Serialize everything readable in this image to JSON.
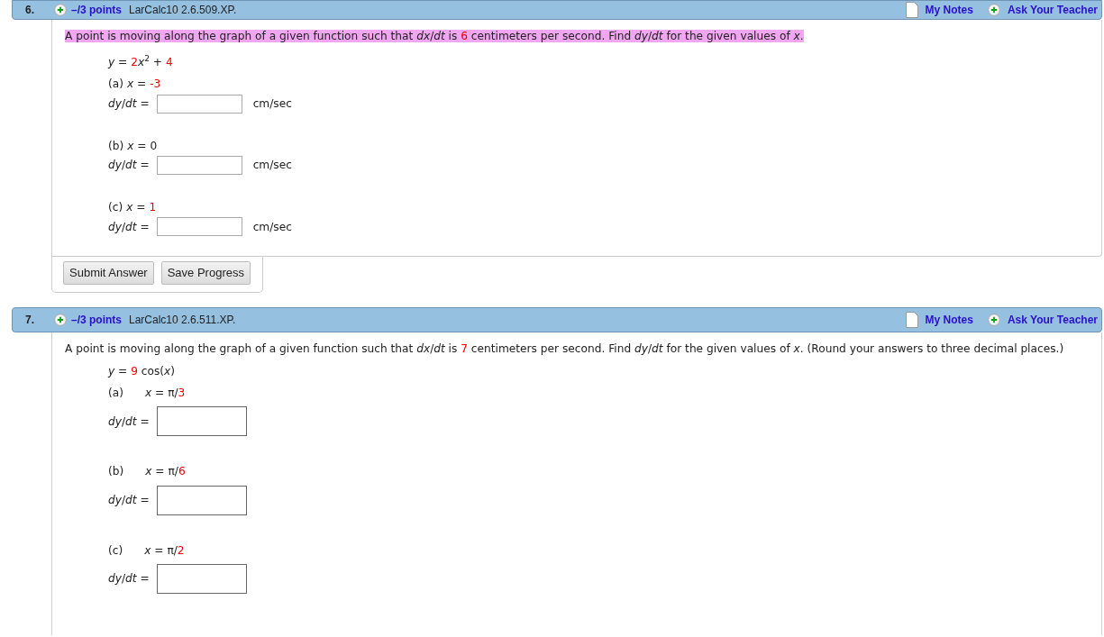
{
  "questions": [
    {
      "number": "6.",
      "points": "–/3 points",
      "code": "LarCalc10 2.6.509.XP.",
      "notes_label": "My Notes",
      "ask_label": "Ask Your Teacher",
      "kind": "compact",
      "highlighted": true,
      "prompt": [
        {
          "text": "A point is moving along the graph of a given function such that *dx*/*dt* is ",
          "red": false
        },
        {
          "text": "6",
          "red": true
        },
        {
          "text": " centimeters per second. Find *dy*/*dt* for the given values of *x*.",
          "red": false
        }
      ],
      "equation": [
        {
          "text": "*y* = ",
          "red": false
        },
        {
          "text": "2",
          "red": true
        },
        {
          "text": "*x*$^{2}$ + ",
          "red": false
        },
        {
          "text": "4",
          "red": true
        }
      ],
      "parts": [
        {
          "label": "(a)",
          "expression": [
            {
              "text": "*x* = ",
              "red": false
            },
            {
              "text": "-3",
              "red": true
            }
          ],
          "answer_label": "*dy*/*dt* =",
          "unit": "cm/sec"
        },
        {
          "label": "(b)",
          "expression": [
            {
              "text": "*x* = 0",
              "red": false
            }
          ],
          "answer_label": "*dy*/*dt* =",
          "unit": "cm/sec"
        },
        {
          "label": "(c)",
          "expression": [
            {
              "text": "*x* = ",
              "red": false
            },
            {
              "text": "1",
              "red": true
            }
          ],
          "answer_label": "*dy*/*dt* =",
          "unit": "cm/sec"
        }
      ],
      "buttons": [
        "Submit Answer",
        "Save Progress"
      ]
    },
    {
      "number": "7.",
      "points": "–/3 points",
      "code": "LarCalc10 2.6.511.XP.",
      "notes_label": "My Notes",
      "ask_label": "Ask Your Teacher",
      "kind": "spaced",
      "highlighted": false,
      "prompt": [
        {
          "text": "A point is moving along the graph of a given function such that *dx*/*dt* is ",
          "red": false
        },
        {
          "text": "7",
          "red": true
        },
        {
          "text": " centimeters per second. Find *dy*/*dt* for the given values of *x*. (Round your answers to three decimal places.)",
          "red": false
        }
      ],
      "equation": [
        {
          "text": "*y* = ",
          "red": false
        },
        {
          "text": "9",
          "red": true
        },
        {
          "text": " cos(*x*)",
          "red": false
        }
      ],
      "parts": [
        {
          "label": "(a)",
          "expression": [
            {
              "text": "*x* = π/",
              "red": false
            },
            {
              "text": "3",
              "red": true
            }
          ],
          "answer_label": "*dy*/*dt* ="
        },
        {
          "label": "(b)",
          "expression": [
            {
              "text": "*x* = π/",
              "red": false
            },
            {
              "text": "6",
              "red": true
            }
          ],
          "answer_label": "*dy*/*dt* ="
        },
        {
          "label": "(c)",
          "expression": [
            {
              "text": "*x* = π/",
              "red": false
            },
            {
              "text": "2",
              "red": true
            }
          ],
          "answer_label": "*dy*/*dt* ="
        }
      ]
    }
  ]
}
